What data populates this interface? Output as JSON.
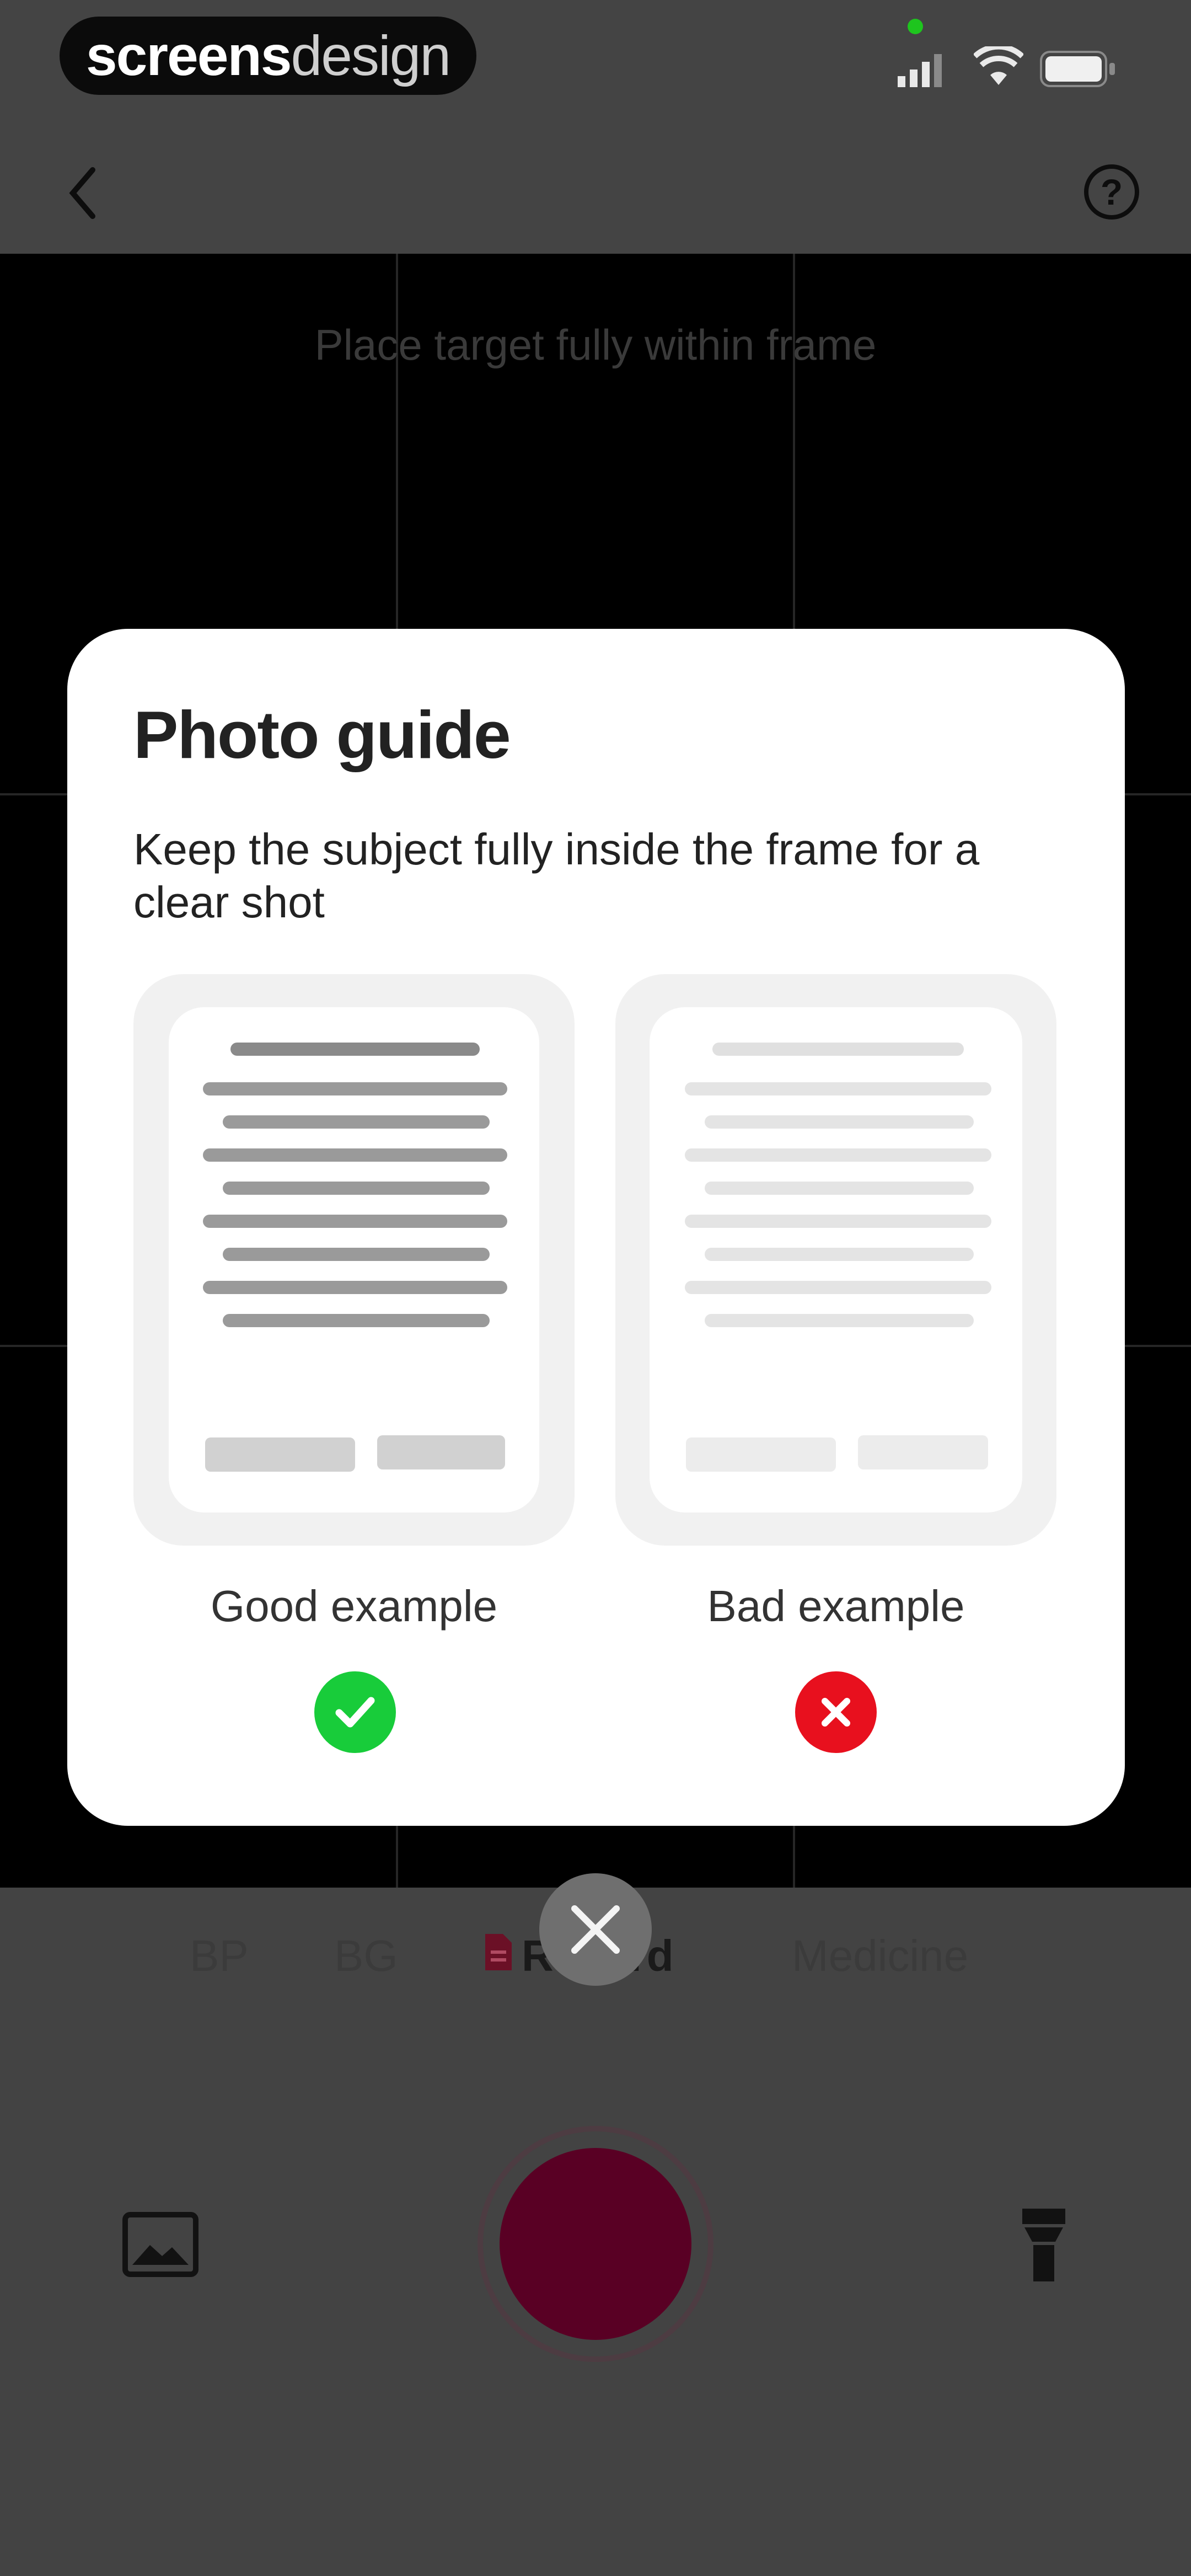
{
  "status_bar": {
    "brand_part1": "screens",
    "brand_part2": "design"
  },
  "camera": {
    "hint": "Place target fully within frame"
  },
  "mode_tabs": [
    {
      "label": "BP"
    },
    {
      "label": "BG"
    },
    {
      "label": "Record"
    },
    {
      "label": "Medicine"
    }
  ],
  "modal": {
    "title": "Photo guide",
    "description": "Keep the subject fully inside the frame for a clear shot",
    "good_label": "Good example",
    "bad_label": "Bad example"
  },
  "icons": {
    "back": "chevron-left-icon",
    "help": "help-circle-icon",
    "close": "close-icon",
    "gallery": "gallery-icon",
    "flash": "flashlight-icon",
    "good": "check-icon",
    "bad": "x-icon",
    "document": "document-icon"
  },
  "colors": {
    "good": "#18cc3a",
    "bad": "#e8101e",
    "shutter": "#590024",
    "overlay": "#444444"
  }
}
